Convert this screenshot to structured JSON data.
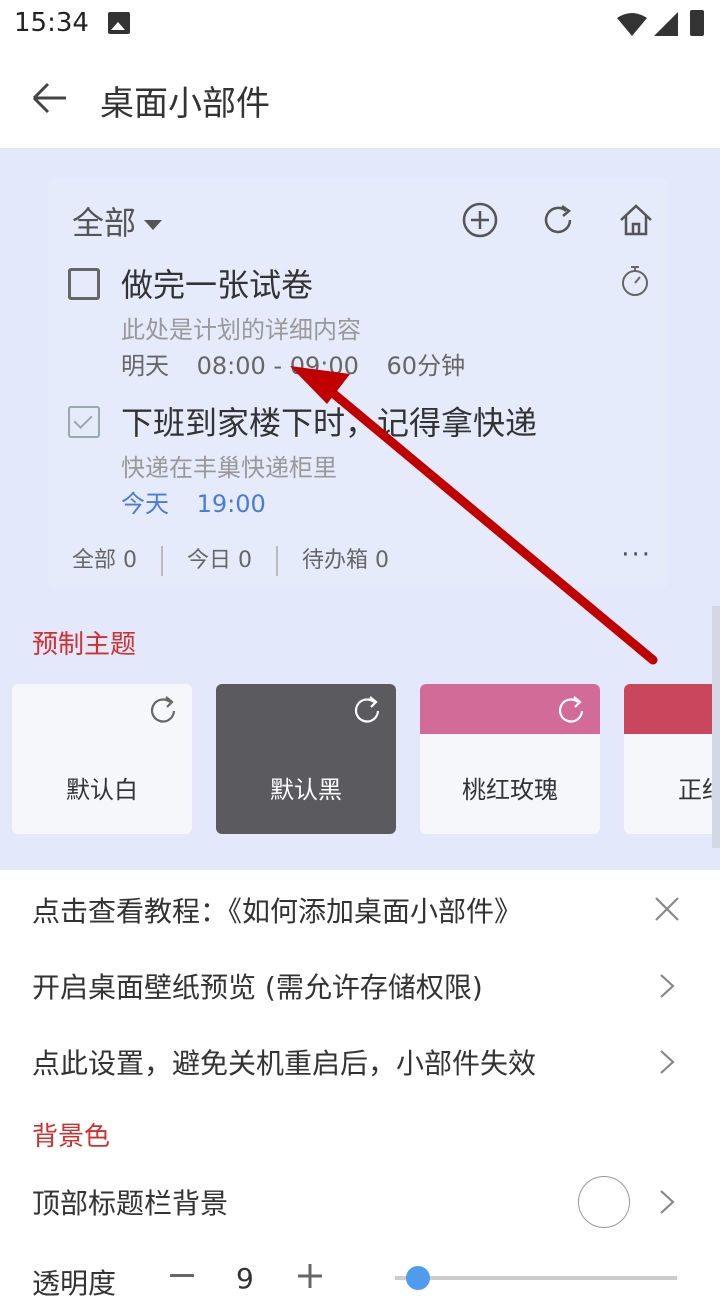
{
  "status": {
    "time": "15:34"
  },
  "appbar": {
    "title": "桌面小部件"
  },
  "widget": {
    "filter": "全部",
    "tasks": [
      {
        "title": "做完一张试卷",
        "desc": "此处是计划的详细内容",
        "day": "明天",
        "time": "08:00 - 09:00",
        "duration": "60分钟",
        "done": false
      },
      {
        "title": "下班到家楼下时，记得拿快递",
        "desc": "快递在丰巢快递柜里",
        "day": "今天",
        "time": "19:00",
        "duration": "",
        "done": true
      }
    ],
    "footer": {
      "all": "全部 0",
      "today": "今日 0",
      "inbox": "待办箱 0",
      "more": "···"
    }
  },
  "themes_section": {
    "label": "预制主题",
    "themes": [
      {
        "name": "默认白",
        "band": ""
      },
      {
        "name": "默认黑",
        "band": ""
      },
      {
        "name": "桃红玫瑰",
        "band": "#d36b98"
      },
      {
        "name": "正红",
        "band": "#c9465c"
      }
    ]
  },
  "rows": {
    "tutorial": "点击查看教程：《如何添加桌面小部件》",
    "wallpaper": "开启桌面壁纸预览 (需允许存储权限)",
    "settings": "点此设置，避免关机重启后，小部件失效"
  },
  "bg_section": {
    "label": "背景色"
  },
  "topbar_bg": {
    "label": "顶部标题栏背景"
  },
  "opacity": {
    "label": "透明度",
    "value": "9"
  },
  "colors": {
    "accent_red": "#d32f2f",
    "blue": "#4a7bd8",
    "preview_bg": "#e3e8fb"
  }
}
